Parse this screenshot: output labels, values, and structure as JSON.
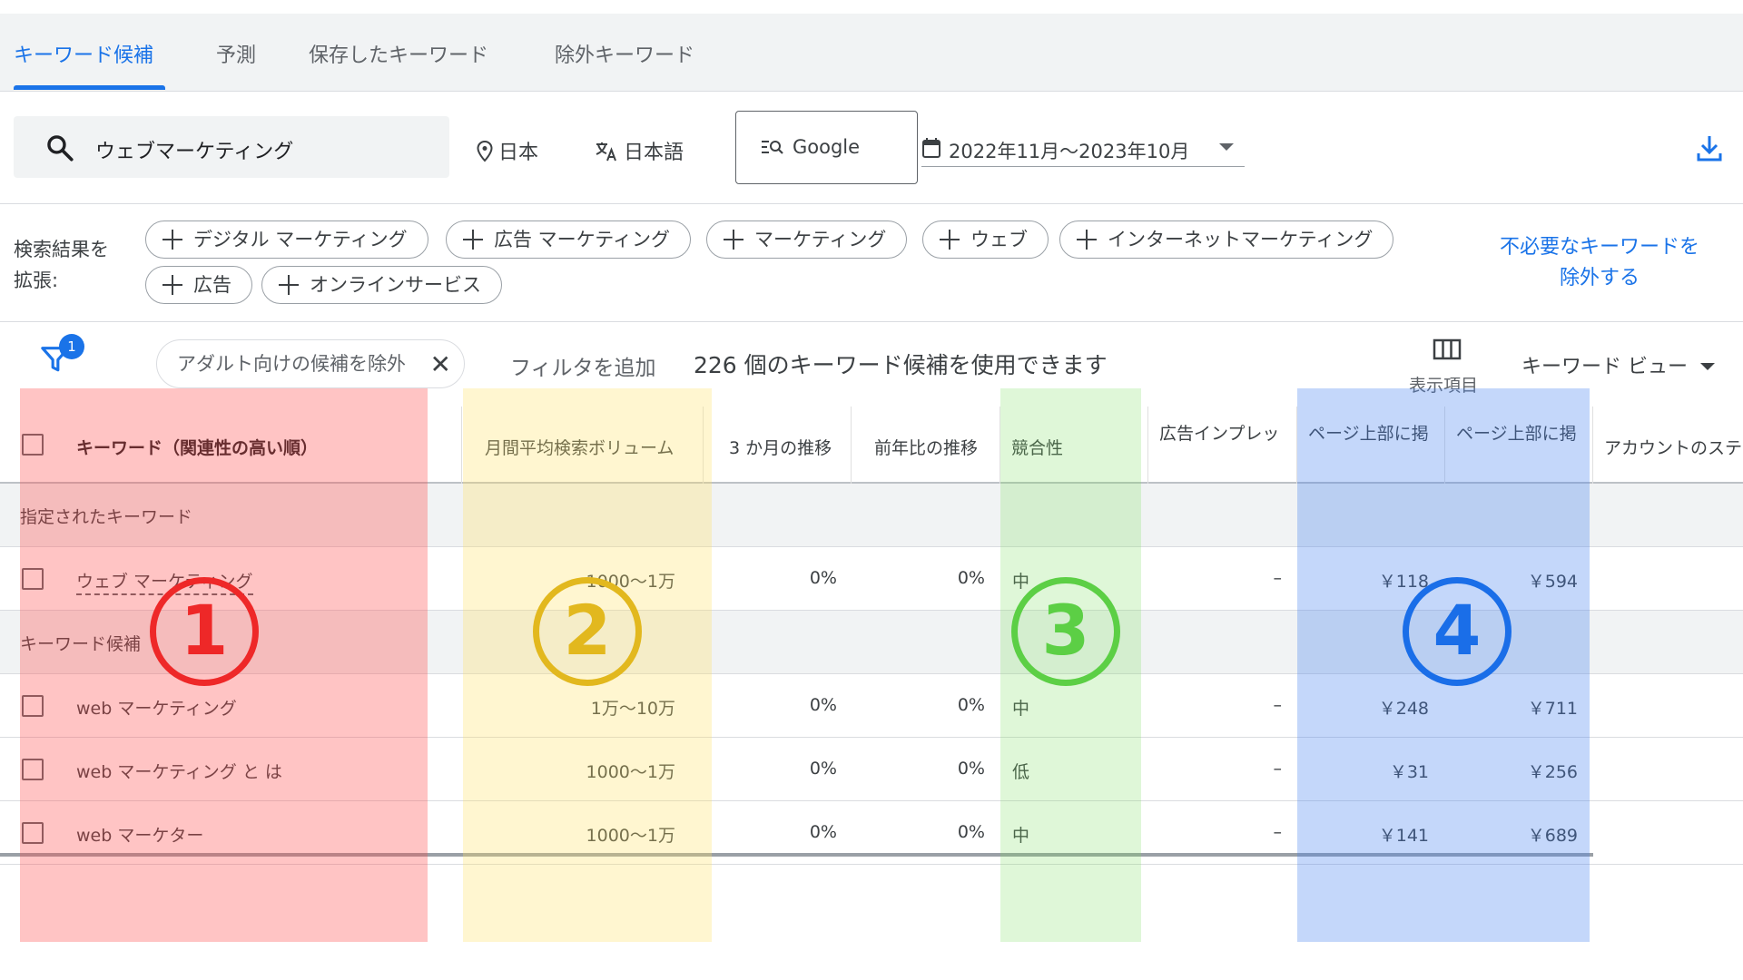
{
  "tabs": [
    {
      "label": "キーワード候補",
      "active": true
    },
    {
      "label": "予測",
      "active": false
    },
    {
      "label": "保存したキーワード",
      "active": false
    },
    {
      "label": "除外キーワード",
      "active": false
    }
  ],
  "search": {
    "query": "ウェブマーケティング"
  },
  "location": "日本",
  "language": "日本語",
  "engine": "Google",
  "date_range": "2022年11月〜2023年10月",
  "expand": {
    "label_line1": "検索結果を",
    "label_line2": "拡張:",
    "chips": [
      "デジタル マーケティング",
      "広告 マーケティング",
      "マーケティング",
      "ウェブ",
      "インターネットマーケティング",
      "広告",
      "オンラインサービス"
    ],
    "exclude_link_line1": "不必要なキーワードを",
    "exclude_link_line2": "除外する"
  },
  "filters": {
    "badge_count": "1",
    "active_filter": "アダルト向けの候補を除外",
    "add_filter": "フィルタを追加",
    "count_text": "226 個のキーワード候補を使用できます",
    "columns_label": "表示項目",
    "view_label": "キーワード ビュー"
  },
  "table": {
    "headers": [
      "キーワード（関連性の高い順）",
      "月間平均検索ボリューム",
      "3 か月の推移",
      "前年比の推移",
      "競合性",
      "広告インプレッ",
      "ページ上部に掲",
      "ページ上部に掲",
      "アカウントのステ"
    ],
    "section_specified": "指定されたキーワード",
    "section_candidates": "キーワード候補",
    "specified_rows": [
      {
        "keyword": "ウェブ マーケティング",
        "volume": "1000〜1万",
        "three_month": "0%",
        "yoy": "0%",
        "competition": "中",
        "impression": "–",
        "top_low": "￥118",
        "top_high": "￥594"
      }
    ],
    "candidate_rows": [
      {
        "keyword": "web マーケティング",
        "volume": "1万〜10万",
        "three_month": "0%",
        "yoy": "0%",
        "competition": "中",
        "impression": "–",
        "top_low": "￥248",
        "top_high": "￥711"
      },
      {
        "keyword": "web マーケティング と は",
        "volume": "1000〜1万",
        "three_month": "0%",
        "yoy": "0%",
        "competition": "低",
        "impression": "–",
        "top_low": "￥31",
        "top_high": "￥256"
      },
      {
        "keyword": "web マーケター",
        "volume": "1000〜1万",
        "three_month": "0%",
        "yoy": "0%",
        "competition": "中",
        "impression": "–",
        "top_low": "￥141",
        "top_high": "￥689"
      }
    ]
  },
  "annotations": [
    {
      "label": "1",
      "color": "#ee2828"
    },
    {
      "label": "2",
      "color": "#e2b81e"
    },
    {
      "label": "3",
      "color": "#5ccf45"
    },
    {
      "label": "4",
      "color": "#1a6ee8"
    }
  ],
  "colors": {
    "accent": "#1a73e8",
    "text": "#3c4043"
  }
}
